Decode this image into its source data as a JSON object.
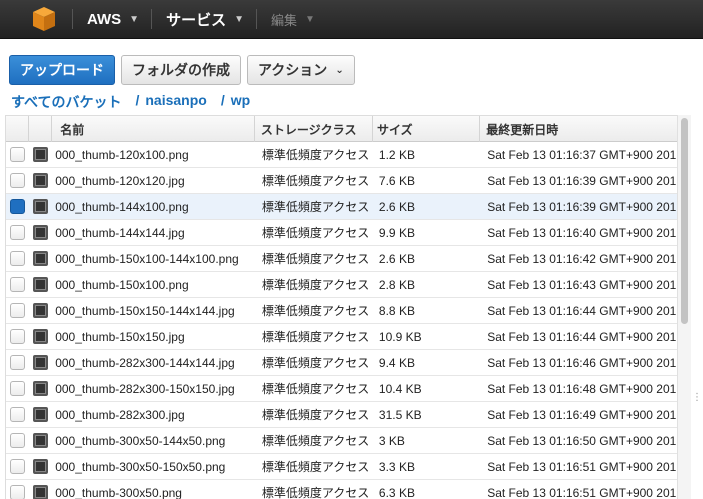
{
  "topbar": {
    "logo_icon": "aws-cube-icon",
    "brand_label": "AWS",
    "services_label": "サービス",
    "edit_label": "編集"
  },
  "toolbar": {
    "upload_label": "アップロード",
    "create_folder_label": "フォルダの作成",
    "actions_label": "アクション"
  },
  "breadcrumb": {
    "items": [
      "すべてのバケット",
      "naisanpo",
      "wp"
    ]
  },
  "table": {
    "headers": {
      "name": "名前",
      "storage_class": "ストレージクラス",
      "size": "サイズ",
      "last_modified": "最終更新日時"
    },
    "rows": [
      {
        "name": "000_thumb-120x100.png",
        "storage_class": "標準低頻度アクセス",
        "size": "1.2 KB",
        "date": "Sat Feb 13 01:16:37 GMT+900 201",
        "selected": false
      },
      {
        "name": "000_thumb-120x120.jpg",
        "storage_class": "標準低頻度アクセス",
        "size": "7.6 KB",
        "date": "Sat Feb 13 01:16:39 GMT+900 201",
        "selected": false
      },
      {
        "name": "000_thumb-144x100.png",
        "storage_class": "標準低頻度アクセス",
        "size": "2.6 KB",
        "date": "Sat Feb 13 01:16:39 GMT+900 201",
        "selected": true
      },
      {
        "name": "000_thumb-144x144.jpg",
        "storage_class": "標準低頻度アクセス",
        "size": "9.9 KB",
        "date": "Sat Feb 13 01:16:40 GMT+900 201",
        "selected": false
      },
      {
        "name": "000_thumb-150x100-144x100.png",
        "storage_class": "標準低頻度アクセス",
        "size": "2.6 KB",
        "date": "Sat Feb 13 01:16:42 GMT+900 201",
        "selected": false
      },
      {
        "name": "000_thumb-150x100.png",
        "storage_class": "標準低頻度アクセス",
        "size": "2.8 KB",
        "date": "Sat Feb 13 01:16:43 GMT+900 201",
        "selected": false
      },
      {
        "name": "000_thumb-150x150-144x144.jpg",
        "storage_class": "標準低頻度アクセス",
        "size": "8.8 KB",
        "date": "Sat Feb 13 01:16:44 GMT+900 201",
        "selected": false
      },
      {
        "name": "000_thumb-150x150.jpg",
        "storage_class": "標準低頻度アクセス",
        "size": "10.9 KB",
        "date": "Sat Feb 13 01:16:44 GMT+900 201",
        "selected": false
      },
      {
        "name": "000_thumb-282x300-144x144.jpg",
        "storage_class": "標準低頻度アクセス",
        "size": "9.4 KB",
        "date": "Sat Feb 13 01:16:46 GMT+900 201",
        "selected": false
      },
      {
        "name": "000_thumb-282x300-150x150.jpg",
        "storage_class": "標準低頻度アクセス",
        "size": "10.4 KB",
        "date": "Sat Feb 13 01:16:48 GMT+900 201",
        "selected": false
      },
      {
        "name": "000_thumb-282x300.jpg",
        "storage_class": "標準低頻度アクセス",
        "size": "31.5 KB",
        "date": "Sat Feb 13 01:16:49 GMT+900 201",
        "selected": false
      },
      {
        "name": "000_thumb-300x50-144x50.png",
        "storage_class": "標準低頻度アクセス",
        "size": "3 KB",
        "date": "Sat Feb 13 01:16:50 GMT+900 201",
        "selected": false
      },
      {
        "name": "000_thumb-300x50-150x50.png",
        "storage_class": "標準低頻度アクセス",
        "size": "3.3 KB",
        "date": "Sat Feb 13 01:16:51 GMT+900 201",
        "selected": false
      },
      {
        "name": "000_thumb-300x50.png",
        "storage_class": "標準低頻度アクセス",
        "size": "6.3 KB",
        "date": "Sat Feb 13 01:16:51 GMT+900 201",
        "selected": false
      }
    ]
  },
  "colors": {
    "topbar_bg": "#232f3e",
    "primary_button": "#1f6fc0",
    "link": "#1a6fb9",
    "selected_row": "#eaf2fb"
  }
}
